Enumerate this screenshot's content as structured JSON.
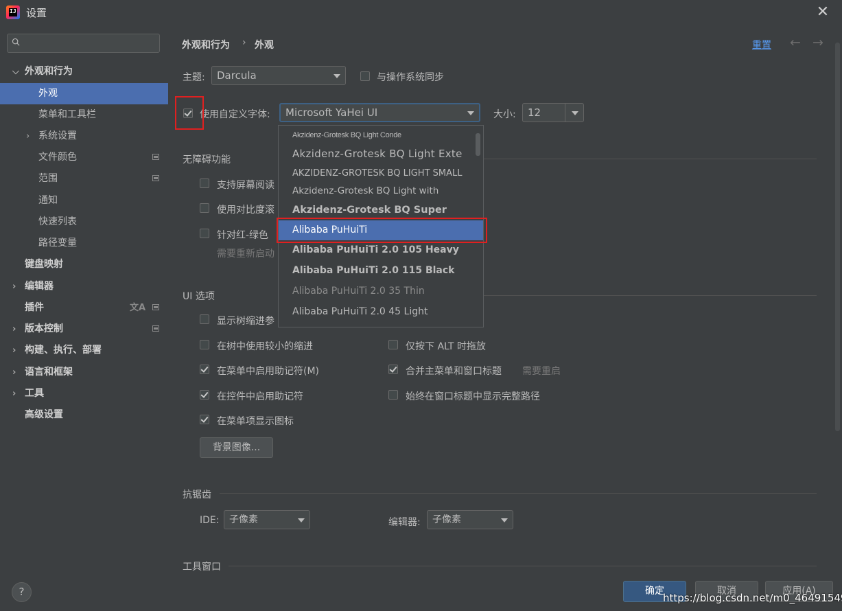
{
  "window": {
    "title": "设置"
  },
  "sidebar": {
    "search_placeholder": "",
    "items": [
      {
        "label": "外观和行为",
        "bold": true,
        "chevron": "v"
      },
      {
        "label": "外观",
        "selected": true
      },
      {
        "label": "菜单和工具栏"
      },
      {
        "label": "系统设置",
        "chevron": ">"
      },
      {
        "label": "文件颜色"
      },
      {
        "label": "范围"
      },
      {
        "label": "通知"
      },
      {
        "label": "快速列表"
      },
      {
        "label": "路径变量"
      },
      {
        "label": "键盘映射",
        "bold": true
      },
      {
        "label": "编辑器",
        "bold": true,
        "chevron": ">"
      },
      {
        "label": "插件",
        "bold": true
      },
      {
        "label": "版本控制",
        "bold": true,
        "chevron": ">"
      },
      {
        "label": "构建、执行、部署",
        "bold": true,
        "chevron": ">"
      },
      {
        "label": "语言和框架",
        "bold": true,
        "chevron": ">"
      },
      {
        "label": "工具",
        "bold": true,
        "chevron": ">"
      },
      {
        "label": "高级设置",
        "bold": true
      }
    ]
  },
  "header": {
    "breadcrumb_parent": "外观和行为",
    "breadcrumb_sep": "›",
    "breadcrumb_current": "外观",
    "reset_label": "重置",
    "back_glyph": "←",
    "forward_glyph": "→"
  },
  "theme": {
    "label": "主题:",
    "value": "Darcula",
    "sync_label": "与操作系统同步",
    "sync_checked": false
  },
  "font": {
    "custom_label": "使用自定义字体:",
    "custom_checked": true,
    "value": "Microsoft YaHei UI",
    "size_label": "大小:",
    "size_value": "12"
  },
  "font_popup": {
    "items": [
      "Akzidenz-Grotesk BQ Light Conde",
      "Akzidenz-Grotesk BQ Light Exte",
      "AKZIDENZ-GROTESK BQ LIGHT SMALL",
      "Akzidenz-Grotesk BQ Light with",
      "Akzidenz-Grotesk BQ Super",
      "Alibaba PuHuiTi",
      "Alibaba PuHuiTi 2.0 105 Heavy",
      "Alibaba PuHuiTi 2.0 115 Black",
      "Alibaba PuHuiTi 2.0 35 Thin",
      "Alibaba PuHuiTi 2.0 45 Light"
    ],
    "selected_index": 5
  },
  "accessibility": {
    "title": "无障碍功能",
    "opt1": "支持屏幕阅读",
    "opt2": "使用对比度滚",
    "opt3": "针对红-绿色",
    "hint": "需要重新启动"
  },
  "ui_options": {
    "title": "UI 选项",
    "tree_indent": "显示树缩进参",
    "smaller_indent": "在树中使用较小的缩进",
    "alt_drag": "仅按下 ALT 时拖放",
    "menu_mnemonic": "在菜单中启用助记符(M)",
    "merge_menu": "合并主菜单和窗口标题",
    "restart_hint": "需要重启",
    "control_mnemonic": "在控件中启用助记符",
    "full_path": "始终在窗口标题中显示完整路径",
    "menu_icons": "在菜单项显示图标",
    "bg_image_button": "背景图像..."
  },
  "antialias": {
    "title": "抗锯齿",
    "ide_label": "IDE:",
    "ide_value": "子像素",
    "editor_label": "编辑器:",
    "editor_value": "子像素"
  },
  "toolwindow": {
    "title": "工具窗口"
  },
  "footer": {
    "help": "?",
    "ok": "确定",
    "cancel": "取消",
    "apply": "应用(A)",
    "watermark": "https://blog.csdn.net/m0_46491549"
  }
}
